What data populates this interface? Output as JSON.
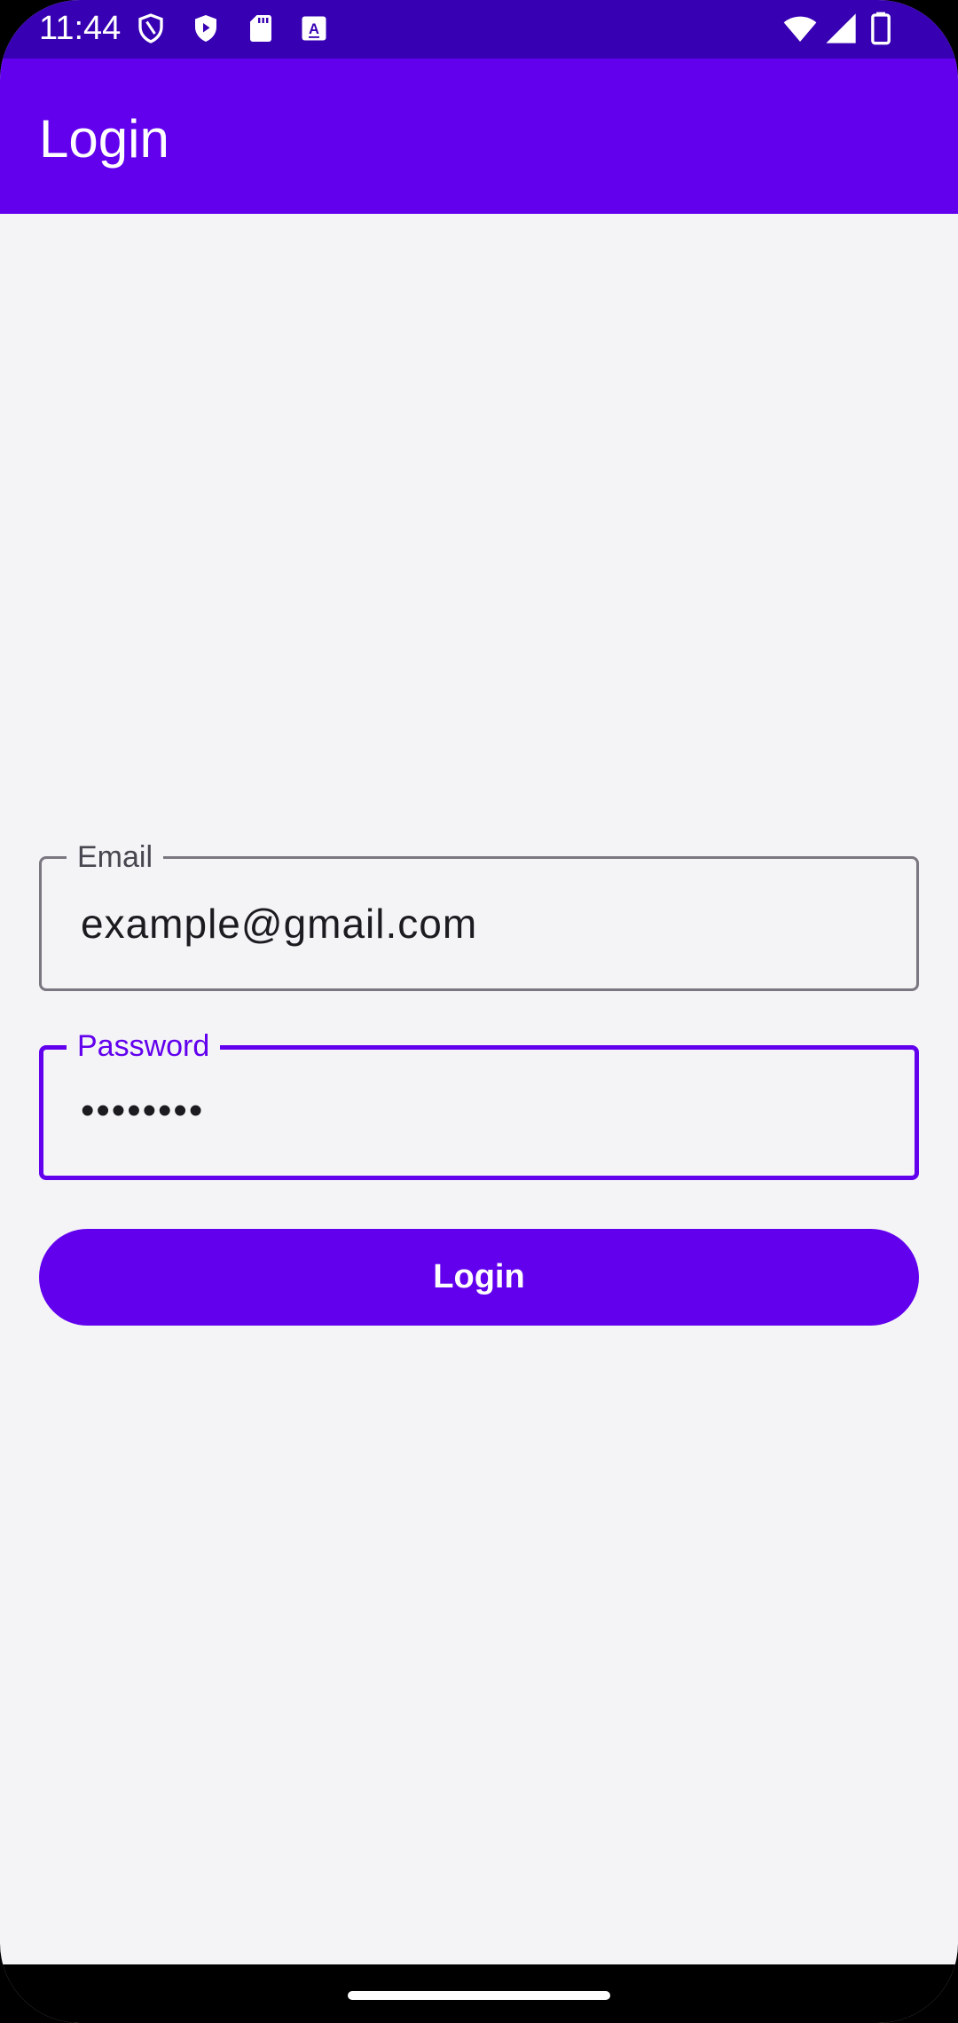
{
  "status_bar": {
    "time": "11:44",
    "left_icons": [
      "shield-outline-icon",
      "play-protect-icon",
      "sd-card-icon",
      "translate-a-icon"
    ],
    "right_icons": [
      "wifi-icon",
      "cellular-signal-icon",
      "battery-icon"
    ]
  },
  "app_bar": {
    "title": "Login"
  },
  "form": {
    "email": {
      "label": "Email",
      "value": "example@gmail.com"
    },
    "password": {
      "label": "Password",
      "value": "••••••••"
    },
    "login_button_label": "Login"
  },
  "colors": {
    "status_bar": "#3700b3",
    "primary": "#6200ee",
    "background": "#f4f3f6",
    "outline": "#7a7780"
  }
}
